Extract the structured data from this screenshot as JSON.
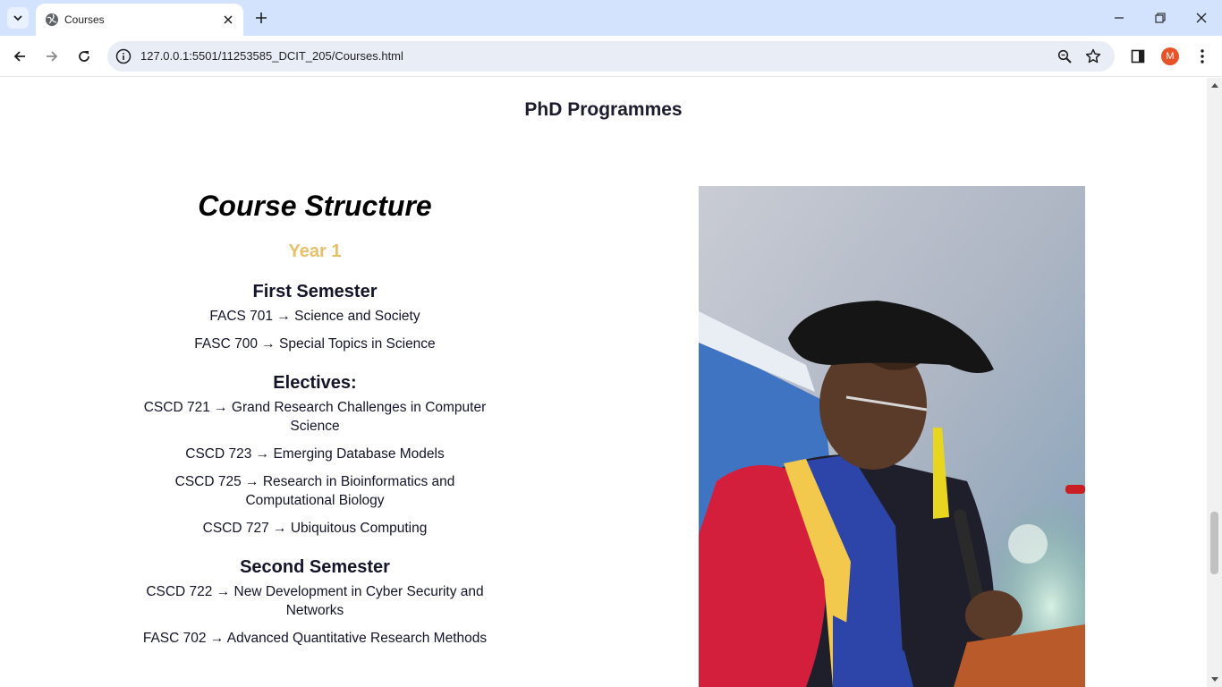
{
  "browser": {
    "tab_title": "Courses",
    "url": "127.0.0.1:5501/11253585_DCIT_205/Courses.html",
    "profile_initial": "M",
    "icons": [
      "tab-search-icon",
      "globe-icon",
      "close-icon",
      "plus-icon",
      "minimize-icon",
      "restore-icon",
      "close-window-icon",
      "back-icon",
      "forward-icon",
      "reload-icon",
      "info-icon",
      "zoom-icon",
      "star-icon",
      "side-panel-icon",
      "kebab-menu-icon"
    ]
  },
  "page": {
    "heading": "PhD Programmes",
    "course_structure": {
      "title": "Course Structure",
      "year": "Year 1",
      "first_semester": {
        "title": "First Semester",
        "courses": [
          "FACS 701 → Science and Society",
          "FASC 700 → Special Topics in Science"
        ]
      },
      "electives": {
        "title": "Electives:",
        "courses": [
          "CSCD 721 → Grand Research Challenges in Computer Science",
          "CSCD 723 → Emerging Database Models",
          "CSCD 725 → Research in Bioinformatics and Computational Biology",
          "CSCD 727 → Ubiquitous Computing"
        ]
      },
      "second_semester": {
        "title": "Second Semester",
        "courses": [
          "CSCD 722 → New Development in Cyber Security and Networks",
          "FASC 702 → Advanced Quantitative Research Methods"
        ]
      }
    }
  }
}
